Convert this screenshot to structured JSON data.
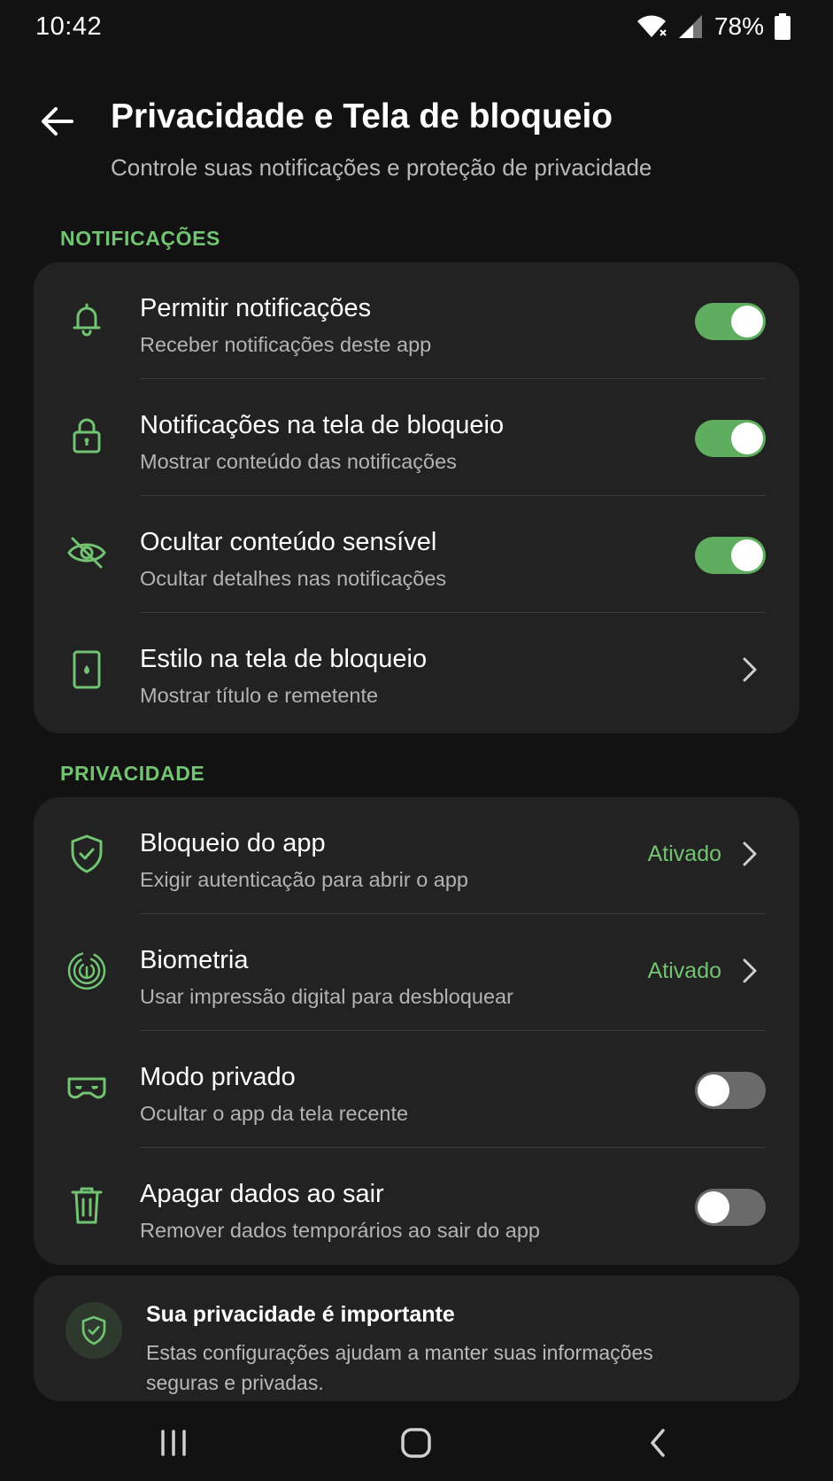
{
  "status_bar": {
    "time": "10:42",
    "battery": "78%"
  },
  "header": {
    "title": "Privacidade e Tela de bloqueio",
    "subtitle": "Controle suas notificações e proteção de privacidade"
  },
  "notifications_section": {
    "label": "NOTIFICAÇÕES",
    "items": [
      {
        "title": "Permitir notificações",
        "subtitle": "Receber notificações deste app",
        "icon": "bell-icon",
        "toggle_on": true
      },
      {
        "title": "Notificações na tela de bloqueio",
        "subtitle": "Mostrar conteúdo das notificações",
        "icon": "lock-icon",
        "toggle_on": true
      },
      {
        "title": "Ocultar conteúdo sensível",
        "subtitle": "Ocultar detalhes nas notificações",
        "icon": "eye-off-icon",
        "toggle_on": true
      },
      {
        "title": "Estilo na tela de bloqueio",
        "subtitle": "Mostrar título e remetente",
        "icon": "phone-lock-icon"
      }
    ]
  },
  "privacy_section": {
    "label": "PRIVACIDADE",
    "items": [
      {
        "title": "Bloqueio do app",
        "subtitle": "Exigir autenticação para abrir o app",
        "icon": "shield-check-icon",
        "value": "Ativado"
      },
      {
        "title": "Biometria",
        "subtitle": "Usar impressão digital para desbloquear",
        "icon": "fingerprint-icon",
        "value": "Ativado"
      },
      {
        "title": "Modo privado",
        "subtitle": "Ocultar o app da tela recente",
        "icon": "mask-icon",
        "toggle_on": false
      },
      {
        "title": "Apagar dados ao sair",
        "subtitle": "Remover dados temporários ao sair do app",
        "icon": "trash-icon",
        "toggle_on": false
      }
    ]
  },
  "info_card": {
    "title": "Sua privacidade é importante",
    "text": "Estas configurações ajudam a manter suas informações seguras e privadas.",
    "icon": "shield-check-icon"
  },
  "colors": {
    "accent": "#72c372",
    "toggle_on": "#5fae5f",
    "background": "#121212",
    "card": "#222222"
  }
}
